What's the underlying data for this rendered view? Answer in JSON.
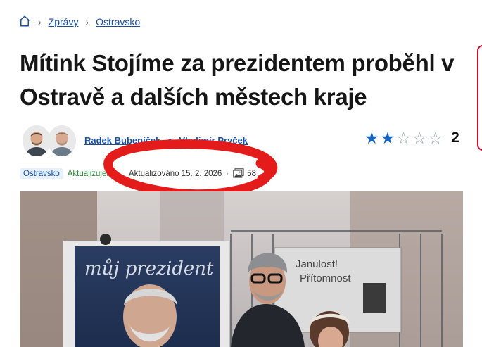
{
  "breadcrumb": {
    "items": [
      {
        "label": "Zprávy"
      },
      {
        "label": "Ostravsko"
      }
    ]
  },
  "article": {
    "title": "Mítink Stojíme za prezidentem proběhl v Ostravě a dalších městech kraje",
    "authors": [
      "Radek Bubeníček",
      "Vladimír Pryček"
    ],
    "rating": {
      "value": 2,
      "max": 5,
      "count_label": "2"
    },
    "meta": {
      "region_tag": "Ostravsko",
      "updated_label": "Aktualizujem",
      "updated_full": "Aktualizováno 15. 2. 2026",
      "separator": "·",
      "photo_count": "58"
    }
  },
  "hero": {
    "sign_text": "můj prezident",
    "board_line1": "Janulost!",
    "board_line2": "Přítomnost"
  },
  "colors": {
    "link": "#1a4fa3",
    "star_filled": "#1565c0",
    "annotation_red": "#e31b1b",
    "updated_green": "#2c8a3a"
  }
}
